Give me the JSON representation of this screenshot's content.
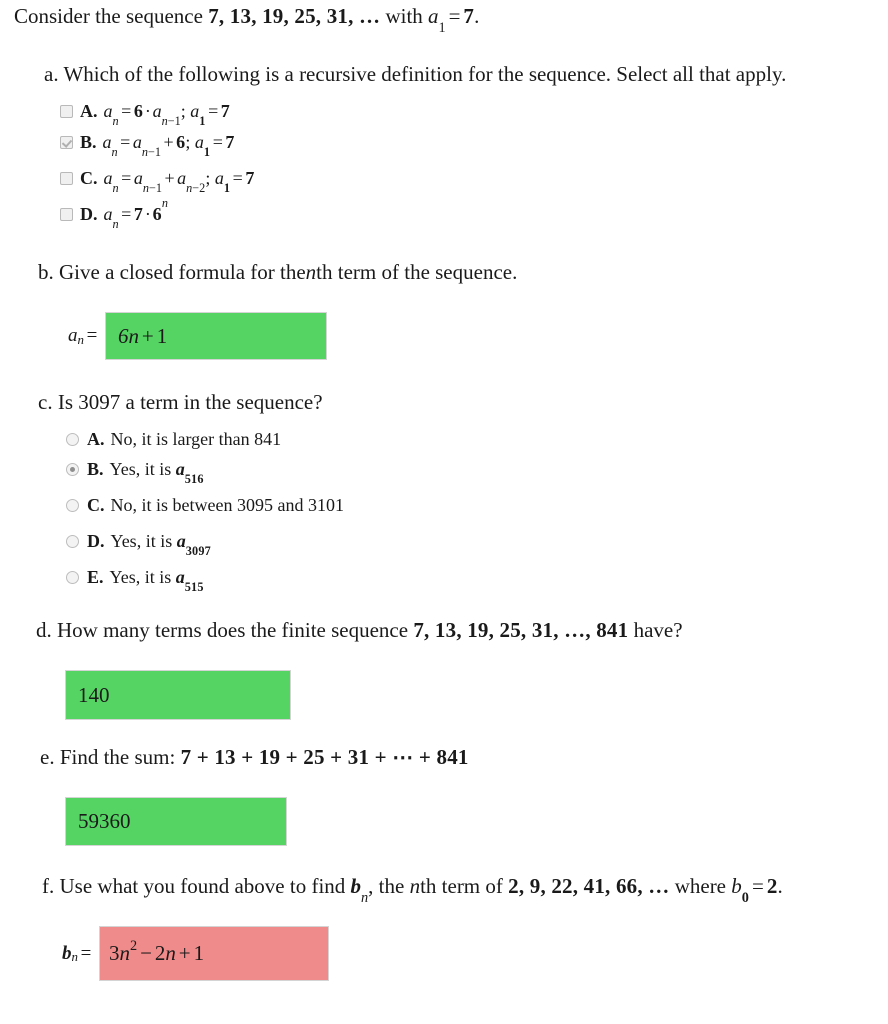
{
  "prompt": {
    "lead": "Consider the sequence",
    "sequence": "7, 13, 19, 25, 31, …",
    "with_word": "with",
    "initial_var": "a",
    "initial_sub": "1",
    "equals": "=",
    "initial_value": "7",
    "period": "."
  },
  "questions": {
    "a": {
      "marker": "a.",
      "text": "Which of the following is a recursive definition for the sequence. Select all that apply.",
      "input_type": "checkbox",
      "options": [
        {
          "letter": "A.",
          "formula": "aₙ = 6 · aₙ₋₁; a₁ = 7",
          "checked": false
        },
        {
          "letter": "B.",
          "formula": "aₙ = aₙ₋₁ + 6; a₁ = 7",
          "checked": true
        },
        {
          "letter": "C.",
          "formula": "aₙ = aₙ₋₁ + aₙ₋₂; a₁ = 7",
          "checked": false
        },
        {
          "letter": "D.",
          "formula": "aₙ = 7 · 6ⁿ",
          "checked": false
        }
      ]
    },
    "b": {
      "marker": "b.",
      "text": "Give a closed formula for the nth term of the sequence.",
      "text_pre": "Give a closed formula for the",
      "text_var": "n",
      "text_post": "th term of the sequence.",
      "answer_prefix_var": "a",
      "answer_prefix_sub": "n",
      "answer_prefix_eq": "=",
      "answer_value": "6n + 1",
      "answer_status": "correct"
    },
    "c": {
      "marker": "c.",
      "text": "Is 3097 a term in the sequence?",
      "text_pre": "Is",
      "text_num": "3097",
      "text_post": "a term in the sequence?",
      "input_type": "radio",
      "options": [
        {
          "letter": "A.",
          "body": "No, it is larger than 841",
          "selected": false
        },
        {
          "letter": "B.",
          "body": "Yes, it is a516",
          "selected": true
        },
        {
          "letter": "C.",
          "body": "No, it is between 3095 and 3101",
          "selected": false
        },
        {
          "letter": "D.",
          "body": "Yes, it is a3097",
          "selected": false
        },
        {
          "letter": "E.",
          "body": "Yes, it is a515",
          "selected": false
        }
      ]
    },
    "d": {
      "marker": "d.",
      "text": "How many terms does the finite sequence 7, 13, 19, 25, 31, …, 841 have?",
      "text_pre": "How many terms does the finite sequence",
      "text_seq": "7, 13, 19, 25, 31, …, 841",
      "text_post": "have?",
      "answer_value": "140",
      "answer_status": "correct"
    },
    "e": {
      "marker": "e.",
      "text": "Find the sum: 7 + 13 + 19 + 25 + 31 + ⋯ + 841",
      "text_pre": "Find the sum:",
      "text_expr": "7 + 13 + 19 + 25 + 31 + ⋯ + 841",
      "answer_value": "59360",
      "answer_status": "correct"
    },
    "f": {
      "marker": "f.",
      "text": "Use what you found above to find bn, the nth term of 2, 9, 22, 41, 66, … where b0 = 2.",
      "text_pre": "Use what you found above to find",
      "text_var1": "b",
      "text_sub1": "n",
      "text_mid": ", the",
      "text_var2": "n",
      "text_mid2": "th term of",
      "text_seq": "2, 9, 22, 41, 66, …",
      "text_where": "where",
      "text_var3": "b",
      "text_sub3": "0",
      "text_eq": "=",
      "text_val3": "2",
      "text_period": ".",
      "answer_prefix_var": "b",
      "answer_prefix_sub": "n",
      "answer_prefix_eq": "=",
      "answer_value": "3n² − 2n + 1",
      "answer_status": "incorrect"
    }
  },
  "colors": {
    "correct_bg": "#55d463",
    "incorrect_bg": "#f08b8b",
    "box_border": "#d4d4d4",
    "text": "#1a1a1a"
  }
}
